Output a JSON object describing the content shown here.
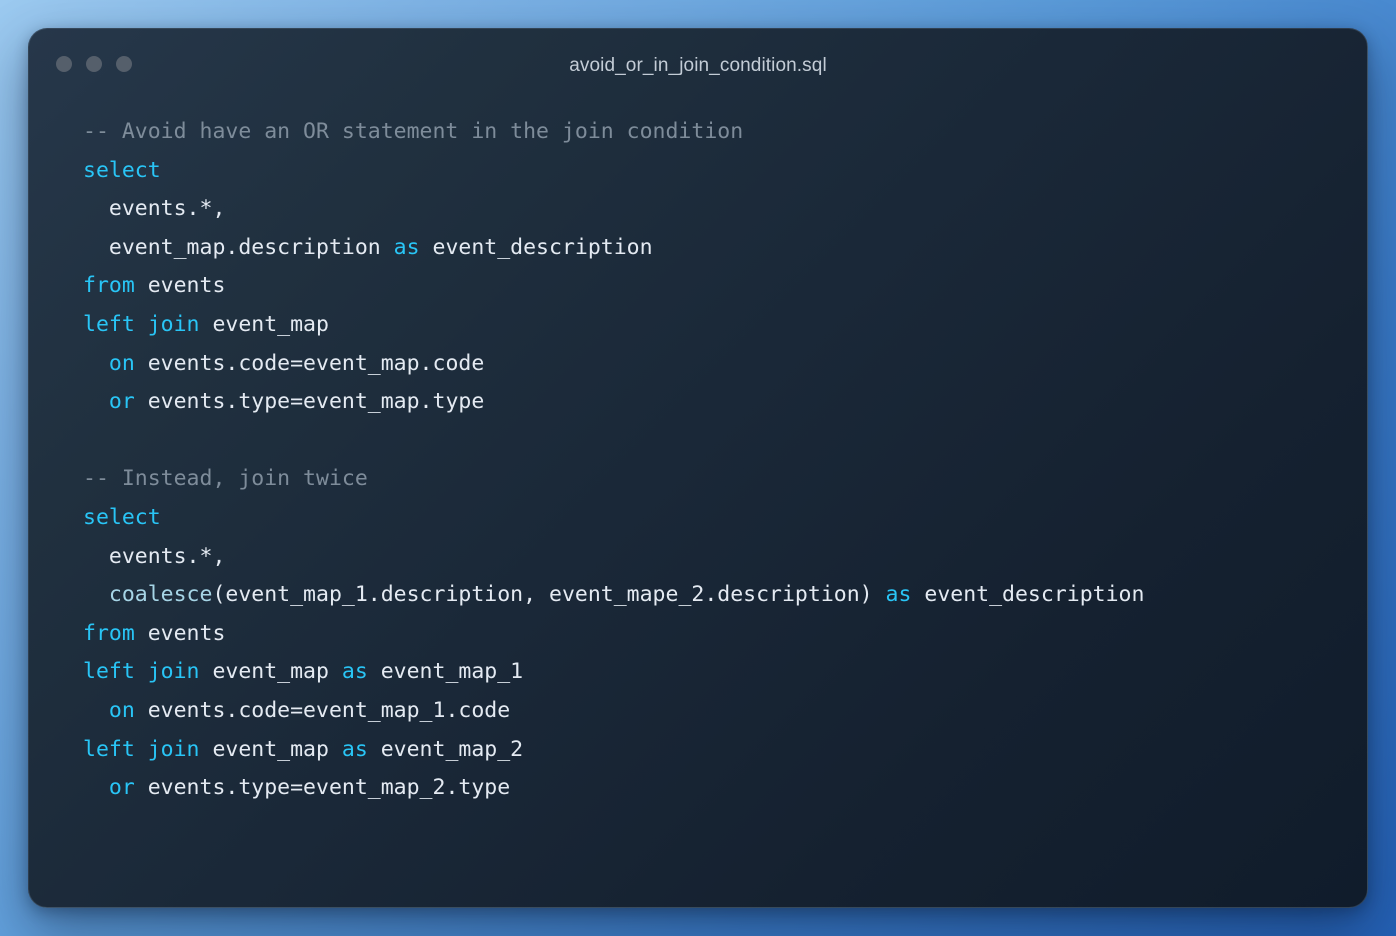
{
  "window": {
    "title": "avoid_or_in_join_condition.sql",
    "traffic_lights": [
      {
        "name": "close-dot",
        "color": "#555F6B"
      },
      {
        "name": "minimize-dot",
        "color": "#555F6B"
      },
      {
        "name": "maximize-dot",
        "color": "#555F6B"
      }
    ]
  },
  "theme": {
    "page_gradient_from": "#9CCAF0",
    "page_gradient_to": "#2460B4",
    "card_gradient_from": "#26374A",
    "card_gradient_to": "#101C2B",
    "keyword_color": "#29C5F6",
    "function_color": "#A6D5E6",
    "comment_color": "#7E8C9A",
    "identifier_color": "#E4EAF2"
  },
  "code": {
    "language": "sql",
    "lines": [
      {
        "n": 1,
        "tokens": [
          {
            "t": "cmt",
            "v": "-- Avoid have an OR statement in the join condition"
          }
        ]
      },
      {
        "n": 2,
        "tokens": [
          {
            "t": "kw",
            "v": "select"
          }
        ]
      },
      {
        "n": 3,
        "tokens": [
          {
            "t": "id",
            "v": "  events.*,"
          }
        ]
      },
      {
        "n": 4,
        "tokens": [
          {
            "t": "id",
            "v": "  event_map.description "
          },
          {
            "t": "kw",
            "v": "as"
          },
          {
            "t": "id",
            "v": " event_description"
          }
        ]
      },
      {
        "n": 5,
        "tokens": [
          {
            "t": "kw",
            "v": "from"
          },
          {
            "t": "id",
            "v": " events"
          }
        ]
      },
      {
        "n": 6,
        "tokens": [
          {
            "t": "kw",
            "v": "left join"
          },
          {
            "t": "id",
            "v": " event_map"
          }
        ]
      },
      {
        "n": 7,
        "tokens": [
          {
            "t": "id",
            "v": "  "
          },
          {
            "t": "kw",
            "v": "on"
          },
          {
            "t": "id",
            "v": " events.code=event_map.code"
          }
        ]
      },
      {
        "n": 8,
        "tokens": [
          {
            "t": "id",
            "v": "  "
          },
          {
            "t": "kw",
            "v": "or"
          },
          {
            "t": "id",
            "v": " events.type=event_map.type"
          }
        ]
      },
      {
        "n": 9,
        "tokens": []
      },
      {
        "n": 10,
        "tokens": [
          {
            "t": "cmt",
            "v": "-- Instead, join twice"
          }
        ]
      },
      {
        "n": 11,
        "tokens": [
          {
            "t": "kw",
            "v": "select"
          }
        ]
      },
      {
        "n": 12,
        "tokens": [
          {
            "t": "id",
            "v": "  events.*,"
          }
        ]
      },
      {
        "n": 13,
        "tokens": [
          {
            "t": "id",
            "v": "  "
          },
          {
            "t": "fn",
            "v": "coalesce"
          },
          {
            "t": "id",
            "v": "(event_map_1.description, event_mape_2.description) "
          },
          {
            "t": "kw",
            "v": "as"
          },
          {
            "t": "id",
            "v": " event_description"
          }
        ]
      },
      {
        "n": 14,
        "tokens": [
          {
            "t": "kw",
            "v": "from"
          },
          {
            "t": "id",
            "v": " events"
          }
        ]
      },
      {
        "n": 15,
        "tokens": [
          {
            "t": "kw",
            "v": "left join"
          },
          {
            "t": "id",
            "v": " event_map "
          },
          {
            "t": "kw",
            "v": "as"
          },
          {
            "t": "id",
            "v": " event_map_1"
          }
        ]
      },
      {
        "n": 16,
        "tokens": [
          {
            "t": "id",
            "v": "  "
          },
          {
            "t": "kw",
            "v": "on"
          },
          {
            "t": "id",
            "v": " events.code=event_map_1.code"
          }
        ]
      },
      {
        "n": 17,
        "tokens": [
          {
            "t": "kw",
            "v": "left join"
          },
          {
            "t": "id",
            "v": " event_map "
          },
          {
            "t": "kw",
            "v": "as"
          },
          {
            "t": "id",
            "v": " event_map_2"
          }
        ]
      },
      {
        "n": 18,
        "tokens": [
          {
            "t": "id",
            "v": "  "
          },
          {
            "t": "kw",
            "v": "or"
          },
          {
            "t": "id",
            "v": " events.type=event_map_2.type"
          }
        ]
      }
    ]
  }
}
